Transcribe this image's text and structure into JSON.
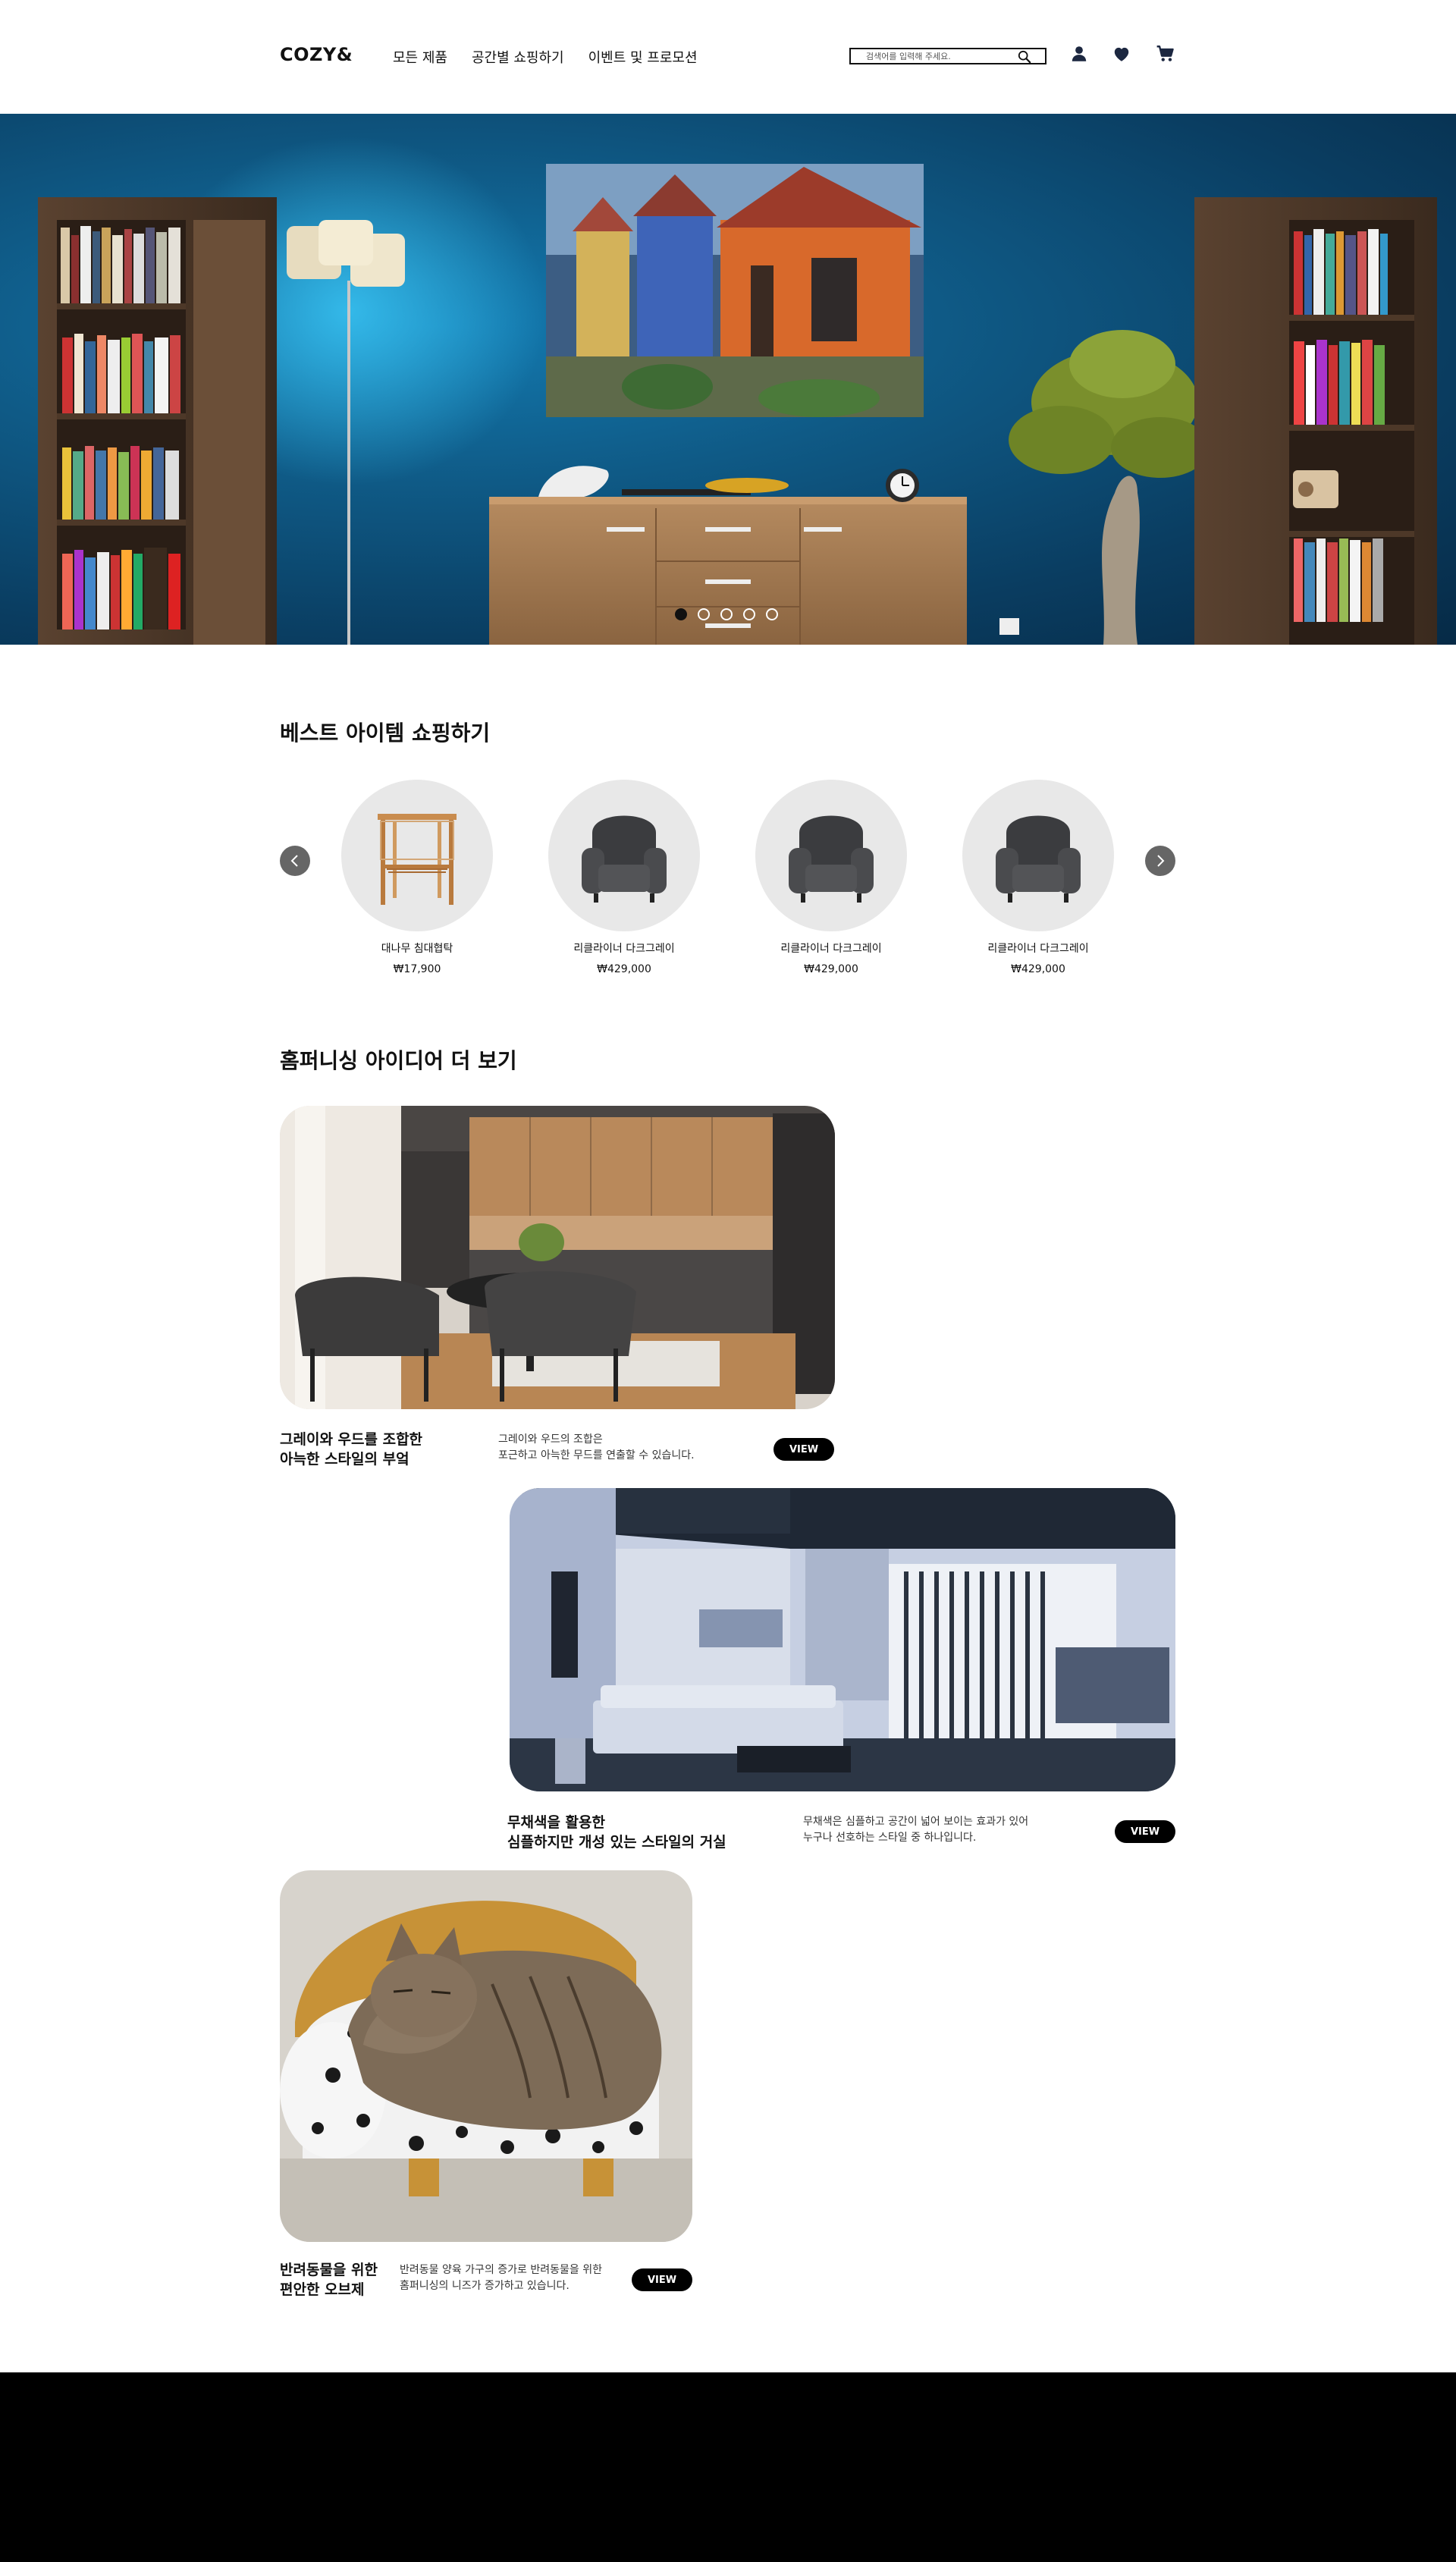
{
  "header": {
    "logo": "COZY&",
    "nav": [
      "모든 제품",
      "공간별 쇼핑하기",
      "이벤트 및 프로모션"
    ],
    "search_placeholder": "검색어를 입력해 주세요.",
    "icons": [
      "search-icon",
      "user-icon",
      "heart-icon",
      "cart-icon"
    ]
  },
  "hero": {
    "slide_count": 5,
    "active_slide": 1
  },
  "best": {
    "title": "베스트 아이템 쇼핑하기",
    "products": [
      {
        "name": "대나무 침대협탁",
        "price": "₩17,900",
        "icon": "side-table"
      },
      {
        "name": "리클라이너 다크그레이",
        "price": "₩429,000",
        "icon": "armchair"
      },
      {
        "name": "리클라이너 다크그레이",
        "price": "₩429,000",
        "icon": "armchair"
      },
      {
        "name": "리클라이너 다크그레이",
        "price": "₩429,000",
        "icon": "armchair"
      }
    ]
  },
  "ideas": {
    "title": "홈퍼니싱 아이디어 더 보기",
    "view_label": "VIEW",
    "items": [
      {
        "title_line1": "그레이와 우드를 조합한",
        "title_line2": "아늑한 스타일의 부엌",
        "desc_line1": "그레이와 우드의 조합은",
        "desc_line2": "포근하고 아늑한 무드를 연출할 수 있습니다."
      },
      {
        "title_line1": "무채색을 활용한",
        "title_line2": "심플하지만 개성 있는 스타일의 거실",
        "desc_line1": "무채색은 심플하고 공간이 넓어 보이는 효과가 있어",
        "desc_line2": "누구나 선호하는 스타일 중 하나입니다."
      },
      {
        "title_line1": "반려동물을 위한",
        "title_line2": "편안한 오브제",
        "desc_line1": "반려동물 양육 가구의 증가로 반려동물을 위한",
        "desc_line2": "홈퍼니싱의 니즈가 증가하고 있습니다."
      }
    ]
  }
}
